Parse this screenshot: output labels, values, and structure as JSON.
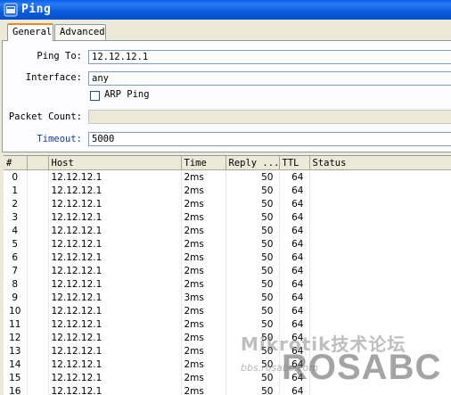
{
  "window": {
    "title": "Ping",
    "title_icon": "mikrotik-window-icon"
  },
  "tabs": [
    {
      "label": "General",
      "active": true
    },
    {
      "label": "Advanced",
      "active": false
    }
  ],
  "form": {
    "ping_to": {
      "label": "Ping To:",
      "value": "12.12.12.1"
    },
    "interface": {
      "label": "Interface:",
      "value": "any"
    },
    "arp_ping": {
      "label": "ARP Ping",
      "checked": false
    },
    "packet_count": {
      "label": "Packet Count:",
      "value": ""
    },
    "timeout": {
      "label": "Timeout:",
      "value": "5000"
    }
  },
  "table": {
    "columns": [
      "#",
      "",
      "Host",
      "Time",
      "Reply ...",
      "TTL",
      "Status"
    ],
    "rows": [
      {
        "idx": "0",
        "host": "12.12.12.1",
        "time": "2ms",
        "reply": "50",
        "ttl": "64",
        "status": ""
      },
      {
        "idx": "1",
        "host": "12.12.12.1",
        "time": "2ms",
        "reply": "50",
        "ttl": "64",
        "status": ""
      },
      {
        "idx": "2",
        "host": "12.12.12.1",
        "time": "2ms",
        "reply": "50",
        "ttl": "64",
        "status": ""
      },
      {
        "idx": "3",
        "host": "12.12.12.1",
        "time": "2ms",
        "reply": "50",
        "ttl": "64",
        "status": ""
      },
      {
        "idx": "4",
        "host": "12.12.12.1",
        "time": "2ms",
        "reply": "50",
        "ttl": "64",
        "status": ""
      },
      {
        "idx": "5",
        "host": "12.12.12.1",
        "time": "2ms",
        "reply": "50",
        "ttl": "64",
        "status": ""
      },
      {
        "idx": "6",
        "host": "12.12.12.1",
        "time": "2ms",
        "reply": "50",
        "ttl": "64",
        "status": ""
      },
      {
        "idx": "7",
        "host": "12.12.12.1",
        "time": "2ms",
        "reply": "50",
        "ttl": "64",
        "status": ""
      },
      {
        "idx": "8",
        "host": "12.12.12.1",
        "time": "2ms",
        "reply": "50",
        "ttl": "64",
        "status": ""
      },
      {
        "idx": "9",
        "host": "12.12.12.1",
        "time": "3ms",
        "reply": "50",
        "ttl": "64",
        "status": ""
      },
      {
        "idx": "10",
        "host": "12.12.12.1",
        "time": "2ms",
        "reply": "50",
        "ttl": "64",
        "status": ""
      },
      {
        "idx": "11",
        "host": "12.12.12.1",
        "time": "2ms",
        "reply": "50",
        "ttl": "64",
        "status": ""
      },
      {
        "idx": "12",
        "host": "12.12.12.1",
        "time": "2ms",
        "reply": "50",
        "ttl": "64",
        "status": ""
      },
      {
        "idx": "13",
        "host": "12.12.12.1",
        "time": "2ms",
        "reply": "50",
        "ttl": "64",
        "status": ""
      },
      {
        "idx": "14",
        "host": "12.12.12.1",
        "time": "2ms",
        "reply": "50",
        "ttl": "64",
        "status": ""
      },
      {
        "idx": "15",
        "host": "12.12.12.1",
        "time": "2ms",
        "reply": "50",
        "ttl": "64",
        "status": ""
      },
      {
        "idx": "16",
        "host": "12.12.12.1",
        "time": "2ms",
        "reply": "50",
        "ttl": "64",
        "status": ""
      }
    ]
  },
  "watermark": {
    "line1": "Mikrotik技术论坛",
    "line2": "ROSABC",
    "line3": "bbs.rosabc.com"
  },
  "colors": {
    "titlebar": "#0a5ee8",
    "window_bg": "#ece9d8",
    "tab_accent": "#e68b2c",
    "timeout_label": "#1a3aa8"
  }
}
